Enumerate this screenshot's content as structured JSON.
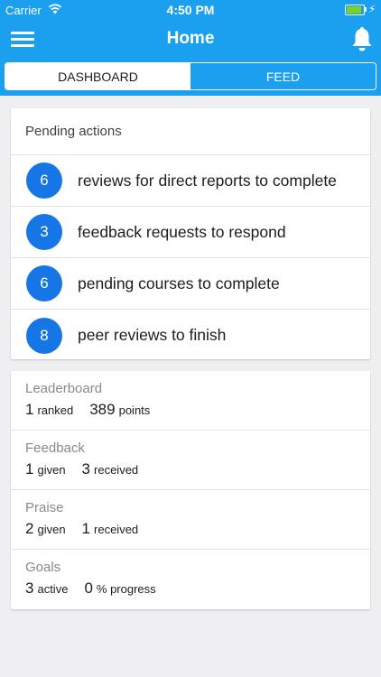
{
  "status": {
    "carrier": "Carrier",
    "time": "4:50 PM",
    "battery_level": 0.9
  },
  "nav": {
    "title": "Home",
    "menu_icon": "hamburger-icon",
    "bell_icon": "bell-icon"
  },
  "tabs": [
    {
      "label": "DASHBOARD",
      "active": true
    },
    {
      "label": "FEED",
      "active": false
    }
  ],
  "pending": {
    "title": "Pending actions",
    "items": [
      {
        "count": "6",
        "text": "reviews for direct reports to complete"
      },
      {
        "count": "3",
        "text": "feedback requests to respond"
      },
      {
        "count": "6",
        "text": "pending courses to complete"
      },
      {
        "count": "8",
        "text": "peer reviews to finish"
      }
    ]
  },
  "stats": [
    {
      "title": "Leaderboard",
      "a_value": "1",
      "a_unit": "ranked",
      "b_value": "389",
      "b_unit": "points"
    },
    {
      "title": "Feedback",
      "a_value": "1",
      "a_unit": "given",
      "b_value": "3",
      "b_unit": "received"
    },
    {
      "title": "Praise",
      "a_value": "2",
      "a_unit": "given",
      "b_value": "1",
      "b_unit": "received"
    },
    {
      "title": "Goals",
      "a_value": "3",
      "a_unit": "active",
      "b_value": "0",
      "b_unit": "% progress"
    }
  ],
  "colors": {
    "brand": "#1aa0ef",
    "badge": "#1776e6",
    "battery": "#7ed321"
  }
}
